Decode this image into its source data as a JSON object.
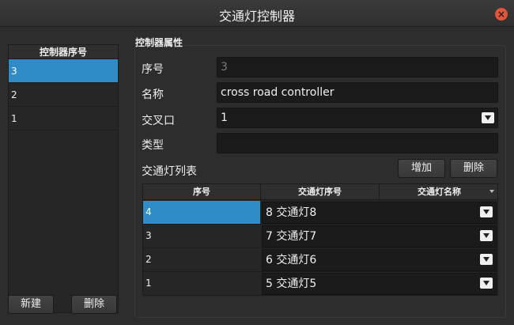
{
  "window": {
    "title": "交通灯控制器",
    "close_icon": "close-icon"
  },
  "left": {
    "header": "控制器序号",
    "rows": [
      "3",
      "2",
      "1"
    ],
    "selected_index": 0,
    "new_label": "新建",
    "delete_label": "删除"
  },
  "group": {
    "title": "控制器属性",
    "seq_label": "序号",
    "seq_value": "3",
    "name_label": "名称",
    "name_value": "cross road controller",
    "cross_label": "交叉口",
    "cross_value": "1",
    "type_label": "类型",
    "type_value": "",
    "lights_label": "交通灯列表",
    "add_label": "增加",
    "remove_label": "删除"
  },
  "lights": {
    "columns": [
      "序号",
      "交通灯序号",
      "交通灯名称"
    ],
    "rows": [
      {
        "seq": "4",
        "light": "8 交通灯8"
      },
      {
        "seq": "3",
        "light": "7 交通灯7"
      },
      {
        "seq": "2",
        "light": "6 交通灯6"
      },
      {
        "seq": "1",
        "light": "5 交通灯5"
      }
    ],
    "selected_index": 0
  },
  "colors": {
    "selection": "#308cc6",
    "close": "#e0553b"
  }
}
